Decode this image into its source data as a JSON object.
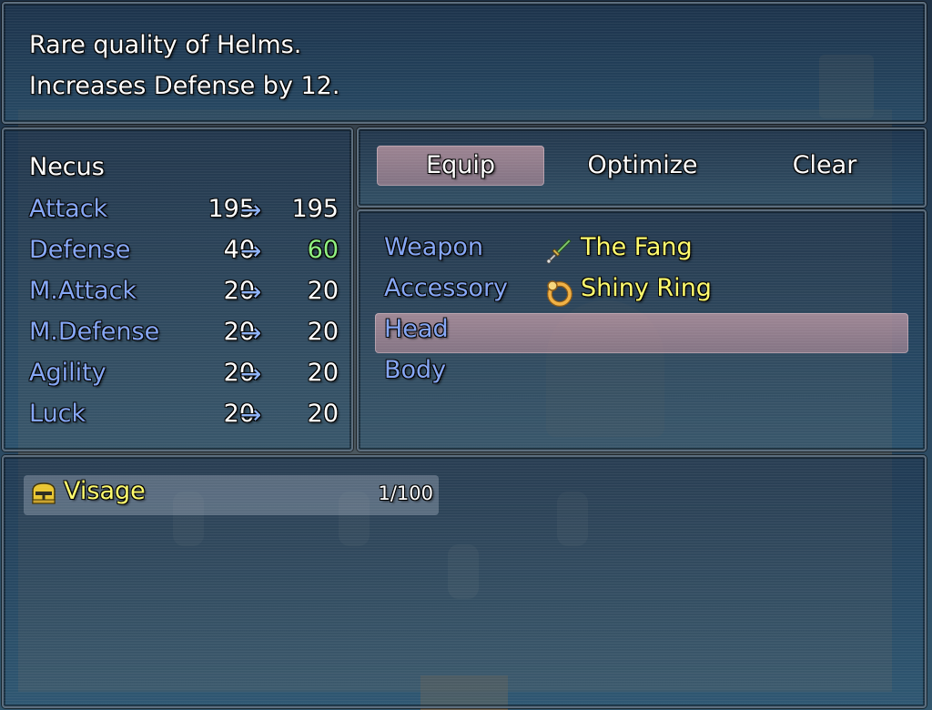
{
  "help": {
    "line1": "Rare quality of Helms.",
    "line2": "Increases Defense by 12."
  },
  "status": {
    "actor": "Necus",
    "arrow": "→",
    "stats": [
      {
        "name": "Attack",
        "current": "195",
        "new": "195"
      },
      {
        "name": "Defense",
        "current": "40",
        "new": "60"
      },
      {
        "name": "M.Attack",
        "current": "20",
        "new": "20"
      },
      {
        "name": "M.Defense",
        "current": "20",
        "new": "20"
      },
      {
        "name": "Agility",
        "current": "20",
        "new": "20"
      },
      {
        "name": "Luck",
        "current": "20",
        "new": "20"
      }
    ]
  },
  "commands": [
    {
      "label": "Equip",
      "selected": true
    },
    {
      "label": "Optimize"
    },
    {
      "label": "Clear"
    }
  ],
  "slots": [
    {
      "label": "Weapon",
      "item": "The Fang",
      "icon": "dagger-icon"
    },
    {
      "label": "Accessory",
      "item": "Shiny Ring",
      "icon": "ring-icon"
    },
    {
      "label": "Head",
      "item": "",
      "selected": true
    },
    {
      "label": "Body",
      "item": ""
    }
  ],
  "items": [
    {
      "name": "Visage",
      "quantity": "1/100",
      "icon": "helm-icon"
    }
  ],
  "colors": {
    "system": "#84a5f4",
    "item_name": "#fefb6c",
    "stat_up": "#8ef07f",
    "cursor": "#d8a9b5"
  }
}
